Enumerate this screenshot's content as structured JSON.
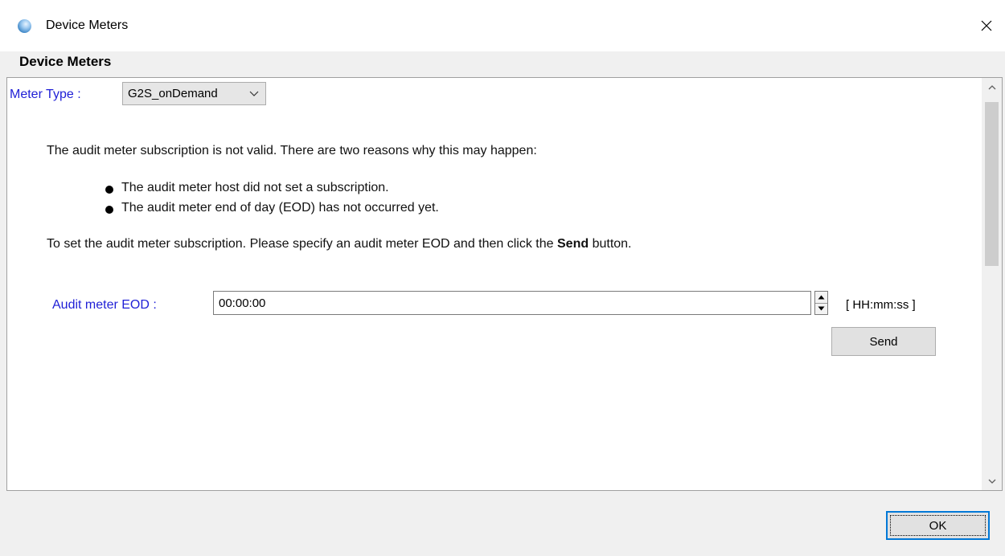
{
  "window": {
    "title": "Device Meters",
    "close_icon": "close-icon"
  },
  "section": {
    "header": "Device Meters"
  },
  "meter_type": {
    "label": "Meter Type :",
    "selected": "G2S_onDemand"
  },
  "message": {
    "intro": "The audit meter subscription is not valid. There are two reasons why this may happen:",
    "reasons": [
      "The audit meter host did not set a subscription.",
      "The audit meter end of day (EOD) has not occurred yet."
    ],
    "instruction_pre": "To set the audit meter subscription. Please specify an audit meter EOD and then click the ",
    "instruction_bold": "Send",
    "instruction_post": " button."
  },
  "eod": {
    "label": "Audit meter EOD :",
    "value": "00:00:00",
    "format_hint": "[ HH:mm:ss ]"
  },
  "buttons": {
    "send": "Send",
    "ok": "OK"
  },
  "colors": {
    "label_blue": "#1f1fd6",
    "focus_border": "#0078d7"
  }
}
